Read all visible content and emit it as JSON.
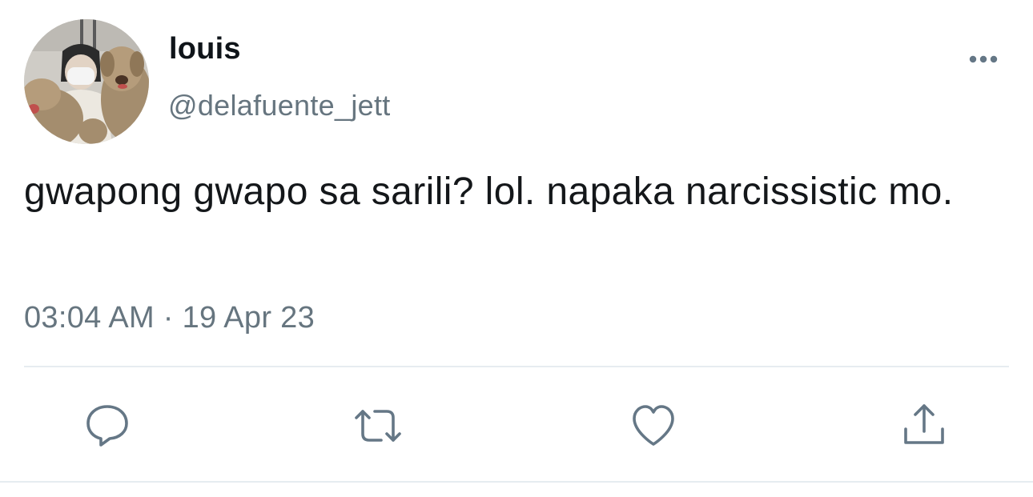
{
  "tweet": {
    "user": {
      "display_name": "louis",
      "handle": "@delafuente_jett"
    },
    "text": "gwapong gwapo sa sarili? lol. napaka narcissistic mo.",
    "timestamp": "03:04 AM · 19 Apr 23"
  },
  "icons": {
    "more": "more-horizontal-icon",
    "reply": "reply-icon",
    "retweet": "retweet-icon",
    "like": "heart-icon",
    "share": "share-icon"
  },
  "colors": {
    "text_primary": "#14171a",
    "text_secondary": "#66757f",
    "icon": "#657786",
    "divider": "#e6ecf0"
  }
}
